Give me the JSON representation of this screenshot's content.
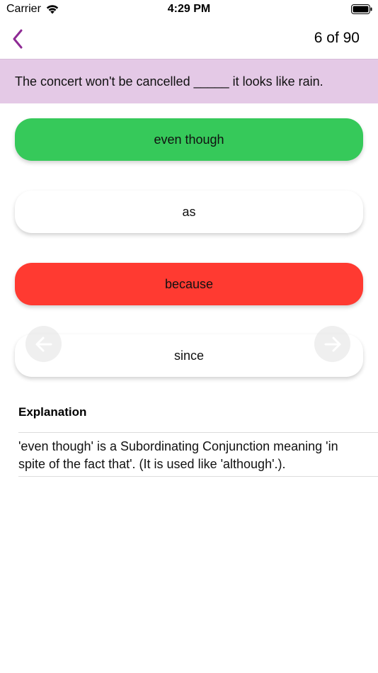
{
  "status_bar": {
    "carrier": "Carrier",
    "time": "4:29 PM"
  },
  "nav": {
    "back_icon": "chevron-left-icon",
    "counter": "6 of 90"
  },
  "question": {
    "text": "The concert won't be cancelled _____ it looks like rain."
  },
  "answers": [
    {
      "label": "even though",
      "state": "correct"
    },
    {
      "label": "as",
      "state": "neutral"
    },
    {
      "label": "because",
      "state": "wrong"
    },
    {
      "label": "since",
      "state": "neutral"
    }
  ],
  "arrows": {
    "prev_icon": "arrow-left-icon",
    "next_icon": "arrow-right-icon"
  },
  "explanation": {
    "title": "Explanation",
    "body": "'even though' is a Subordinating Conjunction meaning 'in spite of the fact that'. (It is used like 'although'.)."
  },
  "colors": {
    "accent": "#8e2a94",
    "question_bg": "#e4c9e6",
    "correct": "#36c95a",
    "wrong": "#ff3a31",
    "neutral": "#ffffff"
  }
}
